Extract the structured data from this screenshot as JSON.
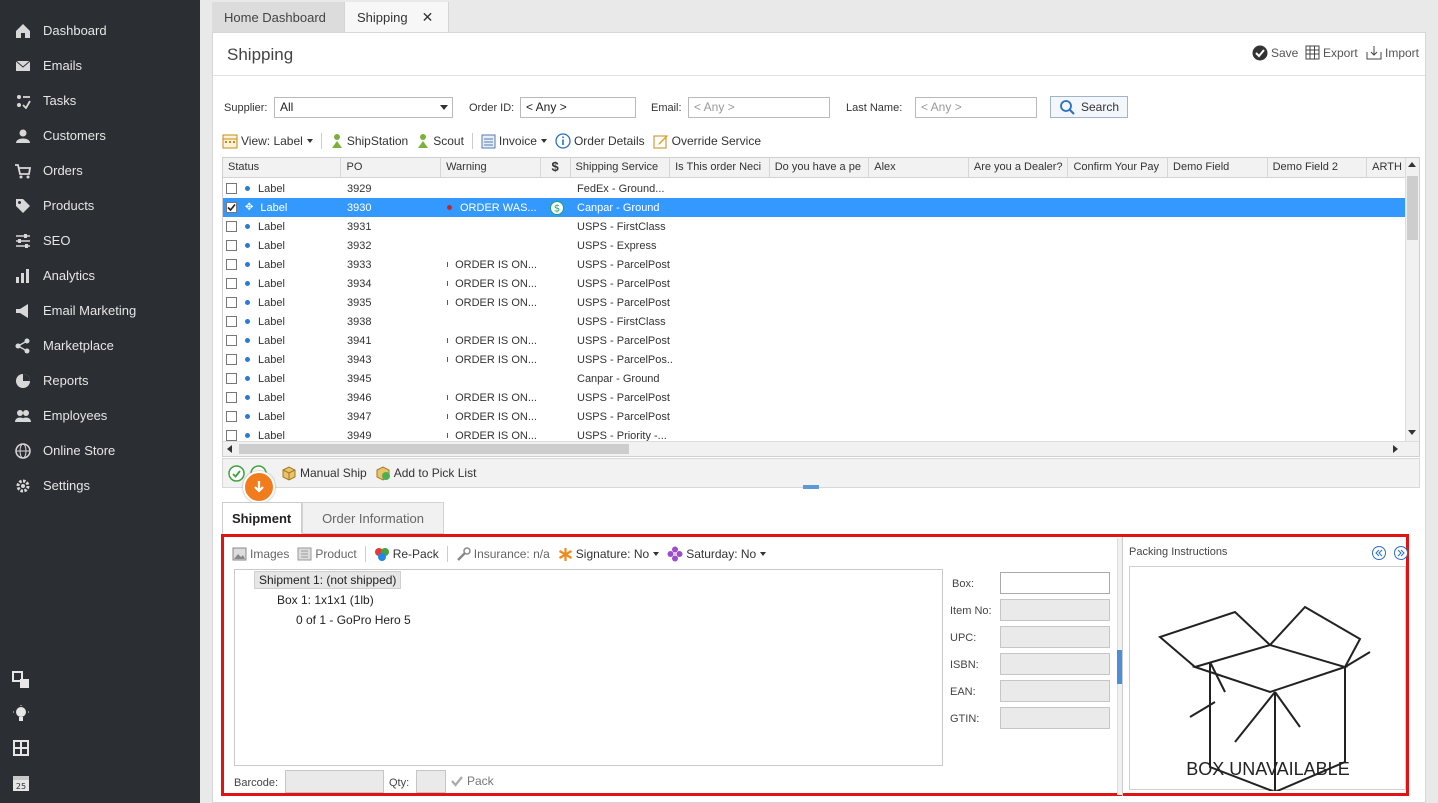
{
  "sidebar": {
    "items": [
      {
        "label": "Dashboard",
        "icon": "home-icon"
      },
      {
        "label": "Emails",
        "icon": "envelope-icon"
      },
      {
        "label": "Tasks",
        "icon": "tasks-icon"
      },
      {
        "label": "Customers",
        "icon": "user-icon"
      },
      {
        "label": "Orders",
        "icon": "cart-icon"
      },
      {
        "label": "Products",
        "icon": "tag-icon"
      },
      {
        "label": "SEO",
        "icon": "sliders-icon"
      },
      {
        "label": "Analytics",
        "icon": "bar-chart-icon"
      },
      {
        "label": "Email Marketing",
        "icon": "megaphone-icon"
      },
      {
        "label": "Marketplace",
        "icon": "share-icon"
      },
      {
        "label": "Reports",
        "icon": "pie-chart-icon"
      },
      {
        "label": "Employees",
        "icon": "users-icon"
      },
      {
        "label": "Online Store",
        "icon": "globe-icon"
      },
      {
        "label": "Settings",
        "icon": "gear-icon"
      }
    ],
    "calendar_day": "25"
  },
  "tabs": [
    {
      "label": "Home Dashboard"
    },
    {
      "label": "Shipping"
    }
  ],
  "page": {
    "title": "Shipping",
    "actions": {
      "save": "Save",
      "export": "Export",
      "import": "Import"
    }
  },
  "filters": {
    "supplier_label": "Supplier:",
    "supplier_value": "All",
    "order_id_label": "Order ID:",
    "order_id_value": "< Any >",
    "email_label": "Email:",
    "email_placeholder": "< Any >",
    "last_name_label": "Last Name:",
    "last_name_placeholder": "< Any >",
    "search_label": "Search"
  },
  "toolbar": {
    "view": "View: Label",
    "shipstation": "ShipStation",
    "scout": "Scout",
    "invoice": "Invoice",
    "order_details": "Order Details",
    "override_service": "Override Service"
  },
  "grid": {
    "columns": [
      "Status",
      "PO",
      "Warning",
      "$",
      "Shipping Service",
      "Is This order Neci",
      "Do you have a pe",
      "Alex",
      "Are you a Dealer?",
      "Confirm Your Pay",
      "Demo Field",
      "Demo Field 2",
      "ARTH"
    ],
    "rows": [
      {
        "status": "Label",
        "po": "3929",
        "warning": "",
        "service": "FedEx - Ground...",
        "checked": false,
        "selected": false,
        "paid": false
      },
      {
        "status": "Label",
        "po": "3930",
        "warning": "ORDER WAS...",
        "service": "Canpar - Ground",
        "checked": true,
        "selected": true,
        "paid": true
      },
      {
        "status": "Label",
        "po": "3931",
        "warning": "",
        "service": "USPS - FirstClass",
        "checked": false,
        "selected": false,
        "paid": false
      },
      {
        "status": "Label",
        "po": "3932",
        "warning": "",
        "service": "USPS - Express",
        "checked": false,
        "selected": false,
        "paid": false
      },
      {
        "status": "Label",
        "po": "3933",
        "warning": "ORDER IS ON...",
        "service": "USPS - ParcelPost",
        "checked": false,
        "selected": false,
        "paid": false
      },
      {
        "status": "Label",
        "po": "3934",
        "warning": "ORDER IS ON...",
        "service": "USPS - ParcelPost",
        "checked": false,
        "selected": false,
        "paid": false
      },
      {
        "status": "Label",
        "po": "3935",
        "warning": "ORDER IS ON...",
        "service": "USPS - ParcelPost",
        "checked": false,
        "selected": false,
        "paid": false
      },
      {
        "status": "Label",
        "po": "3938",
        "warning": "",
        "service": "USPS - FirstClass",
        "checked": false,
        "selected": false,
        "paid": false
      },
      {
        "status": "Label",
        "po": "3941",
        "warning": "ORDER IS ON...",
        "service": "USPS - ParcelPost",
        "checked": false,
        "selected": false,
        "paid": false
      },
      {
        "status": "Label",
        "po": "3943",
        "warning": "ORDER IS ON...",
        "service": "USPS - ParcelPos...",
        "checked": false,
        "selected": false,
        "paid": false
      },
      {
        "status": "Label",
        "po": "3945",
        "warning": "",
        "service": "Canpar - Ground",
        "checked": false,
        "selected": false,
        "paid": false
      },
      {
        "status": "Label",
        "po": "3946",
        "warning": "ORDER IS ON...",
        "service": "USPS - ParcelPost",
        "checked": false,
        "selected": false,
        "paid": false
      },
      {
        "status": "Label",
        "po": "3947",
        "warning": "ORDER IS ON...",
        "service": "USPS - ParcelPost",
        "checked": false,
        "selected": false,
        "paid": false
      },
      {
        "status": "Label",
        "po": "3949",
        "warning": "ORDER IS ON...",
        "service": "USPS - Priority -...",
        "checked": false,
        "selected": false,
        "paid": false
      }
    ]
  },
  "grid_actions": {
    "manual_ship": "Manual Ship",
    "add_to_pick_list": "Add to Pick List"
  },
  "bottom_tabs": [
    {
      "label": "Shipment"
    },
    {
      "label": "Order Information"
    }
  ],
  "shipment": {
    "toolbar": {
      "images": "Images",
      "product": "Product",
      "repack": "Re-Pack",
      "insurance": "Insurance: n/a",
      "signature": "Signature: No",
      "saturday": "Saturday: No"
    },
    "tree": {
      "shipment": "Shipment 1: (not shipped)",
      "box": "Box 1: 1x1x1 (1lb)",
      "item": "0 of 1 - GoPro Hero 5"
    },
    "fields": [
      {
        "label": "Box:"
      },
      {
        "label": "Item No:"
      },
      {
        "label": "UPC:"
      },
      {
        "label": "ISBN:"
      },
      {
        "label": "EAN:"
      },
      {
        "label": "GTIN:"
      }
    ],
    "barcode_label": "Barcode:",
    "qty_label": "Qty:",
    "pack_label": "Pack",
    "packing_title": "Packing Instructions",
    "box_unavailable": "BOX UNAVAILABLE"
  }
}
